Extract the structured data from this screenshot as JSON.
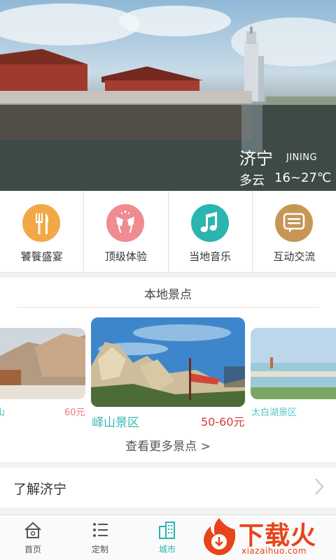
{
  "hero": {
    "city": "济宁",
    "city_en": "JINING",
    "weather": "多云",
    "temperature": "16~27℃"
  },
  "features": [
    {
      "label": "饕餮盛宴",
      "icon": "fork-knife-icon",
      "color": "#f3a847"
    },
    {
      "label": "顶级体验",
      "icon": "toast-glasses-icon",
      "color": "#f08b92"
    },
    {
      "label": "当地音乐",
      "icon": "music-note-icon",
      "color": "#2bb5ae"
    },
    {
      "label": "互动交流",
      "icon": "chat-bubble-icon",
      "color": "#c69656"
    }
  ],
  "scenic": {
    "title": "本地景点",
    "left": {
      "name": "山",
      "price": "60元"
    },
    "main": {
      "name": "峄山景区",
      "price": "50-60元"
    },
    "right": {
      "name": "太白湖景区"
    },
    "more": "查看更多景点 >"
  },
  "know_city": {
    "label": "了解济宁",
    "icon": "chevron-right-icon"
  },
  "tabbar": {
    "tabs": [
      {
        "label": "首页",
        "icon": "home-icon"
      },
      {
        "label": "定制",
        "icon": "list-icon"
      },
      {
        "label": "城市",
        "icon": "building-icon",
        "active": true
      }
    ]
  },
  "watermark": {
    "brand": "下载火",
    "domain": "xiazaihuo.com"
  }
}
